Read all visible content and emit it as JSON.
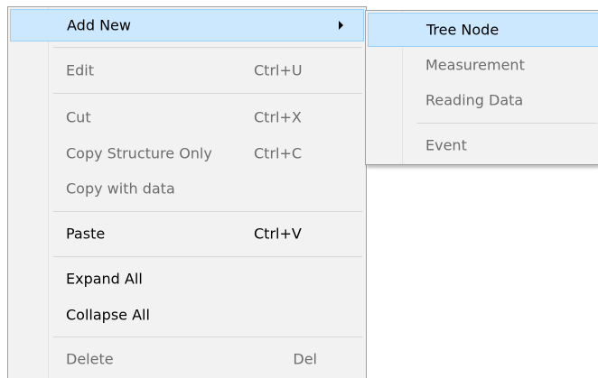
{
  "menu": {
    "add_new": {
      "label": "Add New"
    },
    "edit": {
      "label": "Edit",
      "shortcut": "Ctrl+U"
    },
    "cut": {
      "label": "Cut",
      "shortcut": "Ctrl+X"
    },
    "copy_structure": {
      "label": "Copy Structure Only",
      "shortcut": "Ctrl+C"
    },
    "copy_with_data": {
      "label": "Copy with data"
    },
    "paste": {
      "label": "Paste",
      "shortcut": "Ctrl+V"
    },
    "expand_all": {
      "label": "Expand All"
    },
    "collapse_all": {
      "label": "Collapse All"
    },
    "delete": {
      "label": "Delete",
      "shortcut": "Del"
    }
  },
  "submenu": {
    "tree_node": {
      "label": "Tree Node"
    },
    "measurement": {
      "label": "Measurement"
    },
    "reading_data": {
      "label": "Reading Data"
    },
    "event": {
      "label": "Event"
    }
  },
  "colors": {
    "menu_background": "#f2f2f2",
    "hover_background": "#cce8ff",
    "hover_border": "#99d1ff",
    "disabled_text": "#6d6d6d",
    "enabled_text": "#000000"
  },
  "icons": {
    "submenu_arrow": "chevron-right-icon"
  }
}
